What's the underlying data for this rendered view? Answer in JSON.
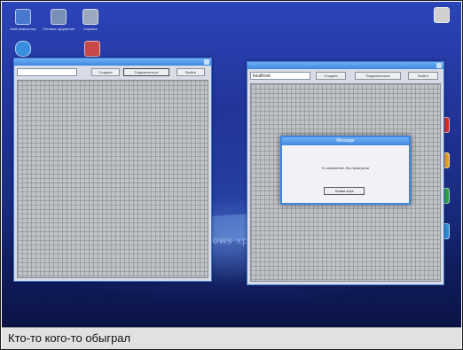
{
  "caption": "Кто-то кого-то обыграл",
  "desktop": {
    "icons": [
      {
        "name": "my-computer-icon",
        "label": "Мой компьютер",
        "color": "#4a78d0"
      },
      {
        "name": "network-icon",
        "label": "Сетевое окружение",
        "color": "#7a8fb8"
      },
      {
        "name": "recycle-bin-icon",
        "label": "Корзина",
        "color": "#9aa8c0"
      },
      {
        "name": "ie-icon",
        "label": "",
        "color": "#3a8ee0"
      },
      {
        "name": "app-icon",
        "label": "",
        "color": "#c84848"
      },
      {
        "name": "right-top-icon",
        "label": "",
        "color": "#d0d0d0"
      },
      {
        "name": "right-icon-1",
        "label": "",
        "color": "#d03030"
      },
      {
        "name": "right-icon-2",
        "label": "",
        "color": "#e8a030"
      },
      {
        "name": "right-icon-3",
        "label": "",
        "color": "#30a050"
      },
      {
        "name": "right-icon-4",
        "label": "",
        "color": "#2f8fd8"
      }
    ],
    "background_text": "ows xp"
  },
  "window_left": {
    "title": "",
    "input_value": "",
    "buttons": [
      "Создать",
      "Подключиться",
      "Выйти"
    ]
  },
  "window_right": {
    "title": "",
    "input_value": "localhost",
    "buttons": [
      "Создать",
      "Подключиться",
      "Выйти"
    ]
  },
  "dialog": {
    "title": "Message",
    "message": "К сожалению, Вы проиграли",
    "ok_label": "Новая игра"
  },
  "colors": {
    "titlebar": "#3f86e0",
    "grid": "#bfc2c6",
    "desktop": "#1f2f8f"
  }
}
